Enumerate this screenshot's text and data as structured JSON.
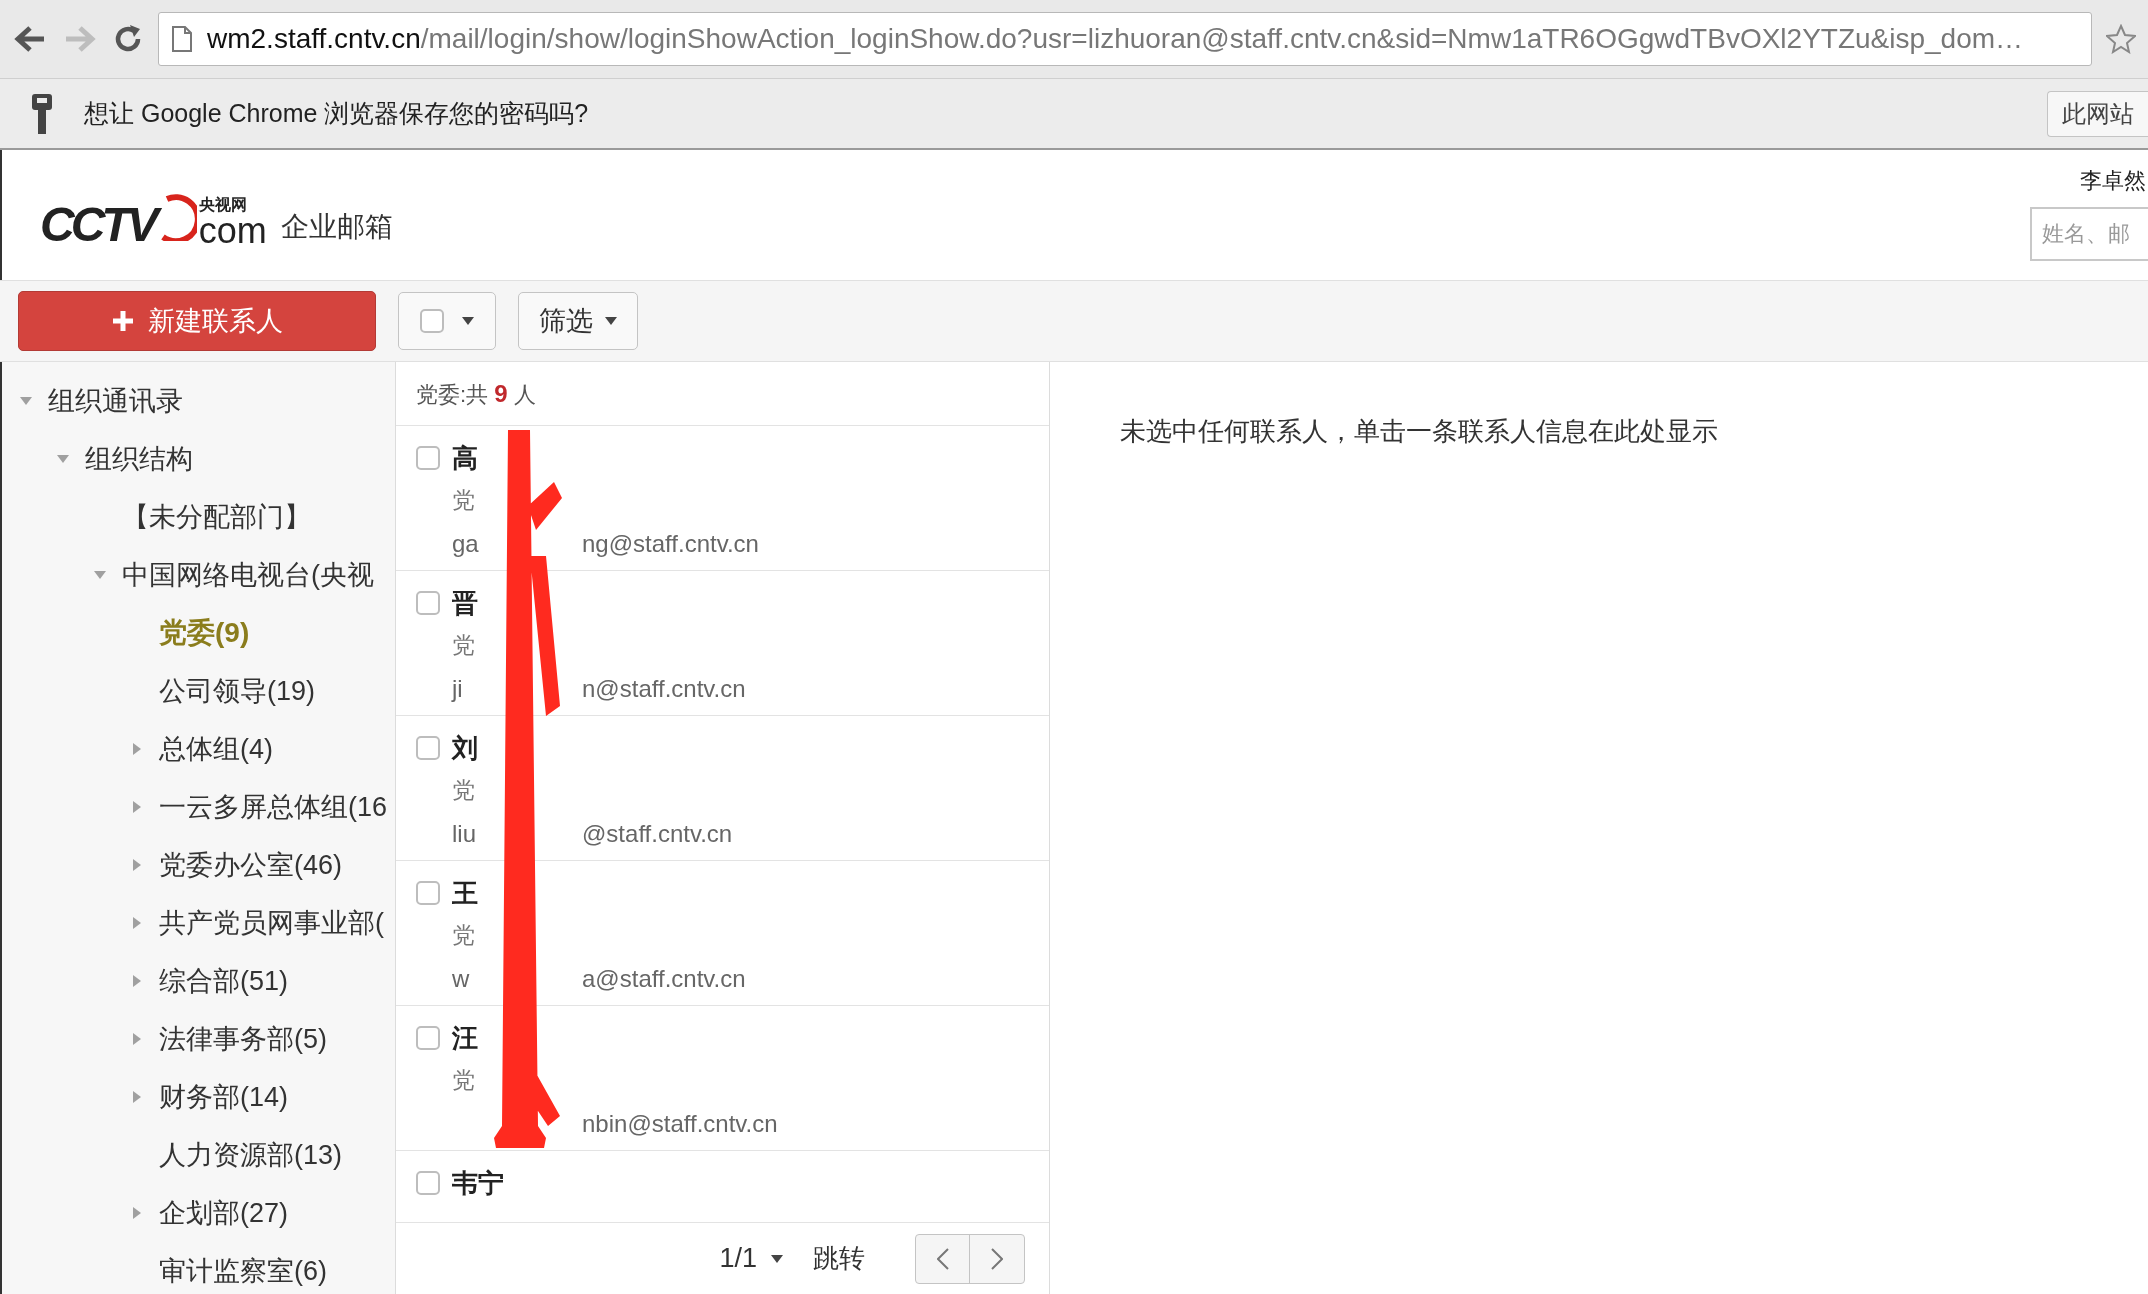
{
  "browser": {
    "url_host": "wm2.staff.cntv.cn",
    "url_path": "/mail/login/show/loginShowAction_loginShow.do?usr=lizhuoran@staff.cntv.cn&sid=Nmw1aTR6OGgwdTBvOXl2YTZu&isp_dom…"
  },
  "infobar": {
    "message": "想让 Google Chrome 浏览器保存您的密码吗?",
    "button": "此网站"
  },
  "header": {
    "logo": {
      "mark": "CCTV",
      "domain": "com",
      "chinese": "央视网"
    },
    "product": "企业邮箱",
    "user": "李卓然",
    "search": {
      "placeholder": "姓名、邮"
    }
  },
  "toolbar": {
    "new_contact": "新建联系人",
    "filter": "筛选",
    "select_all_checked": false
  },
  "tree": [
    {
      "label": "组织通讯录",
      "kind": "branch",
      "expanded": true,
      "selected": false,
      "children": [
        {
          "label": "组织结构",
          "kind": "branch",
          "expanded": true,
          "selected": false,
          "children": [
            {
              "label": "【未分配部门】",
              "kind": "leaf",
              "selected": false
            },
            {
              "label": "中国网络电视台(央视",
              "kind": "branch",
              "expanded": true,
              "selected": false,
              "children": [
                {
                  "label": "党委(9)",
                  "kind": "leaf",
                  "selected": true
                },
                {
                  "label": "公司领导(19)",
                  "kind": "leaf",
                  "selected": false
                },
                {
                  "label": "总体组(4)",
                  "kind": "branch",
                  "expanded": false,
                  "selected": false
                },
                {
                  "label": "一云多屏总体组(16",
                  "kind": "branch",
                  "expanded": false,
                  "selected": false
                },
                {
                  "label": "党委办公室(46)",
                  "kind": "branch",
                  "expanded": false,
                  "selected": false
                },
                {
                  "label": "共产党员网事业部(",
                  "kind": "branch",
                  "expanded": false,
                  "selected": false
                },
                {
                  "label": "综合部(51)",
                  "kind": "branch",
                  "expanded": false,
                  "selected": false
                },
                {
                  "label": "法律事务部(5)",
                  "kind": "branch",
                  "expanded": false,
                  "selected": false
                },
                {
                  "label": "财务部(14)",
                  "kind": "branch",
                  "expanded": false,
                  "selected": false
                },
                {
                  "label": "人力资源部(13)",
                  "kind": "leaf",
                  "selected": false
                },
                {
                  "label": "企划部(27)",
                  "kind": "branch",
                  "expanded": false,
                  "selected": false
                },
                {
                  "label": "审计监察室(6)",
                  "kind": "leaf",
                  "selected": false
                }
              ]
            }
          ]
        }
      ]
    }
  ],
  "list": {
    "group": "党委:共",
    "count": "9",
    "unit": "人",
    "contacts": [
      {
        "name": "高",
        "role": "党",
        "email_start": "ga",
        "email_end": "ng@staff.cntv.cn",
        "checked": false
      },
      {
        "name": "晋",
        "role": "党",
        "email_start": "ji",
        "email_end": "n@staff.cntv.cn",
        "checked": false
      },
      {
        "name": "刘",
        "role": "党",
        "email_start": "liu",
        "email_end": "@staff.cntv.cn",
        "checked": false
      },
      {
        "name": "王",
        "role": "党",
        "email_start": "w",
        "email_end": "a@staff.cntv.cn",
        "checked": false
      },
      {
        "name": "汪",
        "role": "党",
        "email_end": "nbin@staff.cntv.cn",
        "checked": false
      },
      {
        "name": "韦宁",
        "checked": false
      }
    ],
    "pager": {
      "page": "1/1",
      "jump": "跳转"
    }
  },
  "detail": {
    "message": "未选中任何联系人，单击一条联系人信息在此处显示"
  }
}
